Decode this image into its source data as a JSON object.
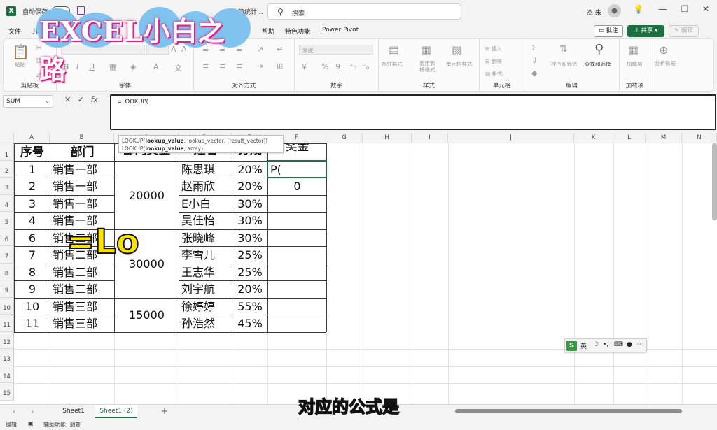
{
  "titlebar": {
    "app_icon": "X",
    "autosave_label": "自动保存",
    "doc_title": "工作簿统计...",
    "search_placeholder": "搜索",
    "user_name": "杰 朱",
    "controls": [
      "minimize",
      "restore",
      "close"
    ]
  },
  "menu": {
    "items": [
      "文件",
      "开",
      "帮助",
      "特色功能",
      "Power Pivot"
    ],
    "comment_label": "批注",
    "share_label": "共享",
    "edit_label": "编辑"
  },
  "ribbon": {
    "groups": [
      {
        "label": "剪贴板",
        "buttons": [
          "粘贴"
        ]
      },
      {
        "label": "字体",
        "buttons": [
          "B",
          "I",
          "U"
        ]
      },
      {
        "label": "对齐方式",
        "buttons": []
      },
      {
        "label": "数字",
        "buttons": [
          "常规",
          "%",
          "9"
        ]
      },
      {
        "label": "样式",
        "buttons": [
          "条件格式",
          "套用表格格式",
          "单元格样式"
        ]
      },
      {
        "label": "单元格",
        "buttons": [
          "插入",
          "删除",
          "格式"
        ]
      },
      {
        "label": "编辑",
        "buttons": [
          "排序和筛选",
          "查找和选择"
        ]
      },
      {
        "label": "加载项",
        "buttons": [
          "加载项"
        ]
      },
      {
        "label": "",
        "buttons": [
          "分析数据"
        ]
      }
    ]
  },
  "formula": {
    "name_box": "SUM",
    "fx": "fx",
    "content": "=LOOKUP(",
    "tooltip_line1_fn": "LOOKUP(",
    "tooltip_line1_a": "lookup_value",
    "tooltip_line1_b": ", lookup_vector, [result_vector])",
    "tooltip_line2_fn": "LOOKUP(",
    "tooltip_line2_a": "lookup_value",
    "tooltip_line2_b": ", array)"
  },
  "columns": [
    "A",
    "B",
    "C",
    "D",
    "E",
    "F",
    "G",
    "H",
    "I",
    "J",
    "K",
    "L",
    "M",
    "N"
  ],
  "rows": [
    "1",
    "2",
    "3",
    "4",
    "5",
    "6",
    "7",
    "8",
    "9",
    "10",
    "11",
    "12",
    "13",
    "14",
    "15"
  ],
  "table": {
    "headers": [
      "序号",
      "部门",
      "部门奖金",
      "姓名",
      "分成",
      "奖金"
    ],
    "data": [
      [
        "1",
        "销售一部",
        "陈思琪",
        "20%",
        "P("
      ],
      [
        "2",
        "销售一部",
        "赵雨欣",
        "20%",
        "0"
      ],
      [
        "3",
        "销售一部",
        "E小白",
        "30%",
        ""
      ],
      [
        "4",
        "销售一部",
        "吴佳怡",
        "30%",
        ""
      ],
      [
        "6",
        "销售二部",
        "张晓峰",
        "30%",
        ""
      ],
      [
        "7",
        "销售二部",
        "李雪儿",
        "25%",
        ""
      ],
      [
        "8",
        "销售二部",
        "王志华",
        "25%",
        ""
      ],
      [
        "9",
        "销售二部",
        "刘宇航",
        "20%",
        ""
      ],
      [
        "10",
        "销售三部",
        "徐婷婷",
        "55%",
        ""
      ],
      [
        "11",
        "销售三部",
        "孙浩然",
        "45%",
        ""
      ]
    ],
    "bonus_merged": [
      "20000",
      "30000",
      "15000"
    ]
  },
  "ime": {
    "logo": "S",
    "lang": "英"
  },
  "sheets": {
    "tabs": [
      "Sheet1",
      "Sheet1 (2)"
    ],
    "add": "+"
  },
  "status": {
    "mode": "编辑",
    "accessibility": "辅助功能: 调查"
  },
  "overlay": {
    "logo": "EXCEL小白之路",
    "big_text": "=Lo",
    "subtitle": "对应的公式是"
  }
}
